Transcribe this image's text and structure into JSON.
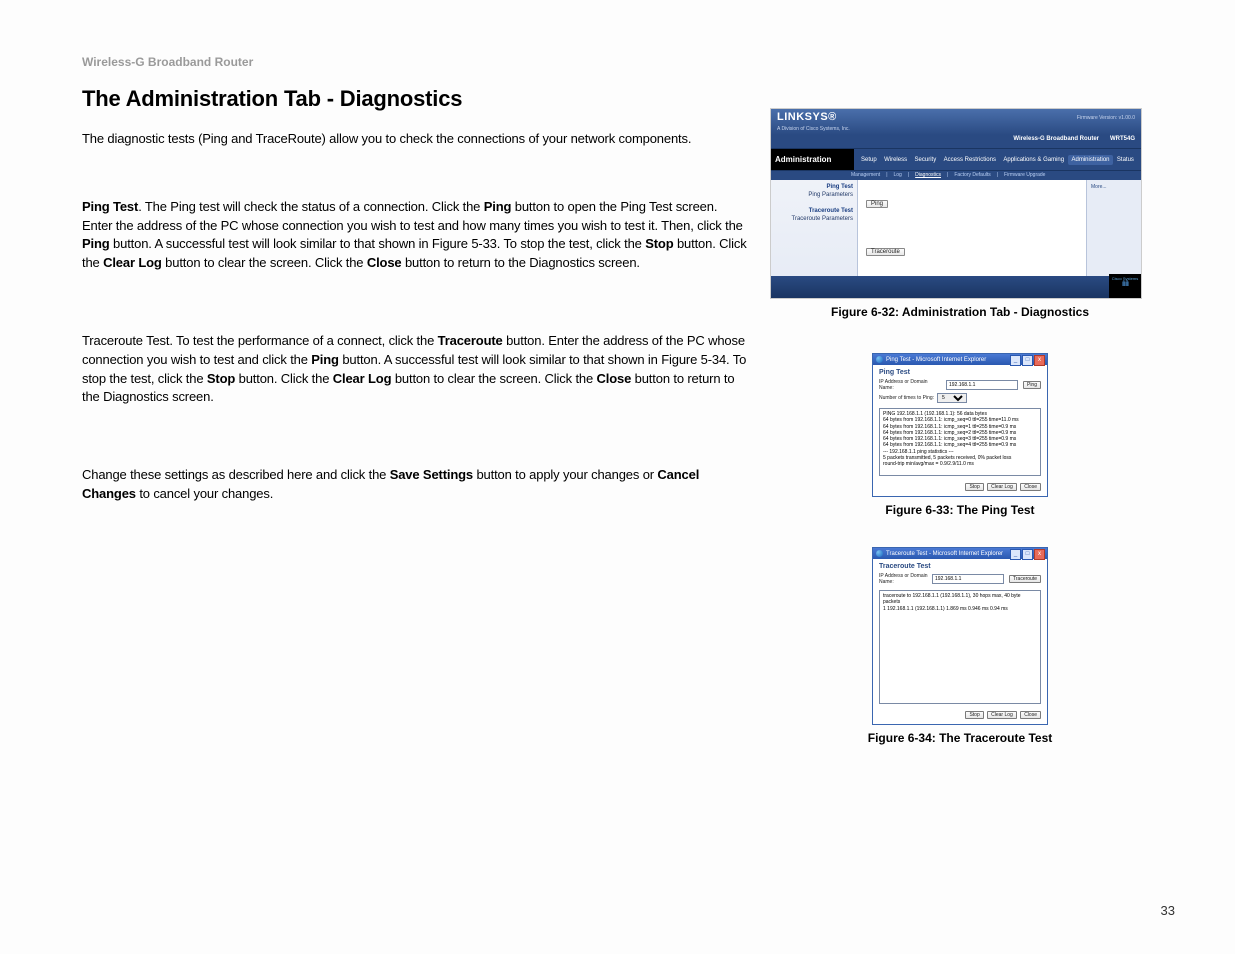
{
  "pageHeader": "Wireless-G Broadband Router",
  "pageNumber": "33",
  "heading": "The Administration Tab - Diagnostics",
  "intro": "The diagnostic tests (Ping and TraceRoute) allow you to check the connections of your network components.",
  "ping_label": "Ping Test",
  "ping_sentence_after_label": ". The Ping test will check the status of a connection. Click the ",
  "b_ping1": "Ping",
  "ping_s2": " button to open the Ping Test screen. Enter the address of the PC whose connection you wish to test and how many times you wish to test it. Then, click the ",
  "b_ping2": "Ping",
  "ping_s3": " button. A successful test will look similar to that shown in Figure 5-33. To stop the test, click the ",
  "b_stop1": "Stop",
  "ping_s4": " button. Click the ",
  "b_clearlog1": "Clear Log",
  "ping_s5": " button to clear the screen. Click the ",
  "b_close1": "Close",
  "ping_s6": " button to return to the Diagnostics screen.",
  "trace_s1": "Traceroute Test. To test the performance of a connect, click the ",
  "b_traceroute": "Traceroute",
  "trace_s2": " button. Enter the address of the PC whose connection you wish to test and click the ",
  "b_ping3": "Ping",
  "trace_s3": " button. A successful test will look similar to that shown in Figure 5-34. To stop the test, click the ",
  "b_stop2": "Stop",
  "trace_s4": " button. Click the ",
  "b_clearlog2": "Clear Log",
  "trace_s5": " button to clear the screen. Click the ",
  "b_close2": "Close",
  "trace_s6": " button to return to the Diagnostics screen.",
  "save_s1": "Change these settings as described here and click the ",
  "b_save": "Save Settings",
  "save_s2": " button to apply your changes or ",
  "b_cancel": "Cancel Changes",
  "save_s3": " to cancel your changes.",
  "fig1": {
    "logo": "LINKSYS®",
    "division": "A Division of Cisco Systems, Inc.",
    "firmware": "Firmware Version: v1.00.0",
    "productTitle": "Wireless-G Broadband Router",
    "model": "WRT54G",
    "navLabel": "Administration",
    "tabs": [
      "Setup",
      "Wireless",
      "Security",
      "Access\nRestrictions",
      "Applications\n& Gaming",
      "Administration",
      "Status"
    ],
    "subnav": [
      "Management",
      "Log",
      "Diagnostics",
      "Factory Defaults",
      "Firmware Upgrade"
    ],
    "side": {
      "pingTestHead": "Ping Test",
      "pingParamsLabel": "Ping Parameters",
      "traceHead": "Traceroute Test",
      "traceParamsLabel": "Traceroute Parameters"
    },
    "pingBtn": "Ping",
    "traceBtn": "Traceroute",
    "help": "More...",
    "ciscoTop": "Cisco Systems",
    "caption": "Figure 6-32: Administration Tab - Diagnostics"
  },
  "fig2": {
    "winTitle": "Ping Test - Microsoft Internet Explorer",
    "heading": "Ping Test",
    "ipLabel": "IP Address or Domain Name:",
    "ipValue": "192.168.1.1",
    "pingBtn": "Ping",
    "numLabel": "Number of times to Ping:",
    "numValue": "5",
    "output": "PING 192.168.1.1 (192.168.1.1): 56 data bytes\n64 bytes from 192.168.1.1: icmp_seq=0 ttl=255 time=11.0 ms\n64 bytes from 192.168.1.1: icmp_seq=1 ttl=255 time=0.9 ms\n64 bytes from 192.168.1.1: icmp_seq=2 ttl=255 time=0.9 ms\n64 bytes from 192.168.1.1: icmp_seq=3 ttl=255 time=0.9 ms\n64 bytes from 192.168.1.1: icmp_seq=4 ttl=255 time=0.9 ms\n--- 192.168.1.1 ping statistics ---\n5 packets transmitted, 5 packets received, 0% packet loss\nround-trip min/avg/max = 0.9/2.9/11.0 ms",
    "btnStop": "Stop",
    "btnClear": "Clear Log",
    "btnClose": "Close",
    "caption": "Figure 6-33: The Ping Test"
  },
  "fig3": {
    "winTitle": "Traceroute Test - Microsoft Internet Explorer",
    "heading": "Traceroute Test",
    "ipLabel": "IP Address or Domain Name:",
    "ipValue": "192.168.1.1",
    "traceBtn": "Traceroute",
    "output": "traceroute to 192.168.1.1 (192.168.1.1), 30 hops max, 40 byte packets\n1 192.168.1.1 (192.168.1.1) 1.869 ms 0.946 ms 0.94 ms",
    "btnStop": "Stop",
    "btnClear": "Clear Log",
    "btnClose": "Close",
    "caption": "Figure 6-34: The Traceroute Test"
  }
}
